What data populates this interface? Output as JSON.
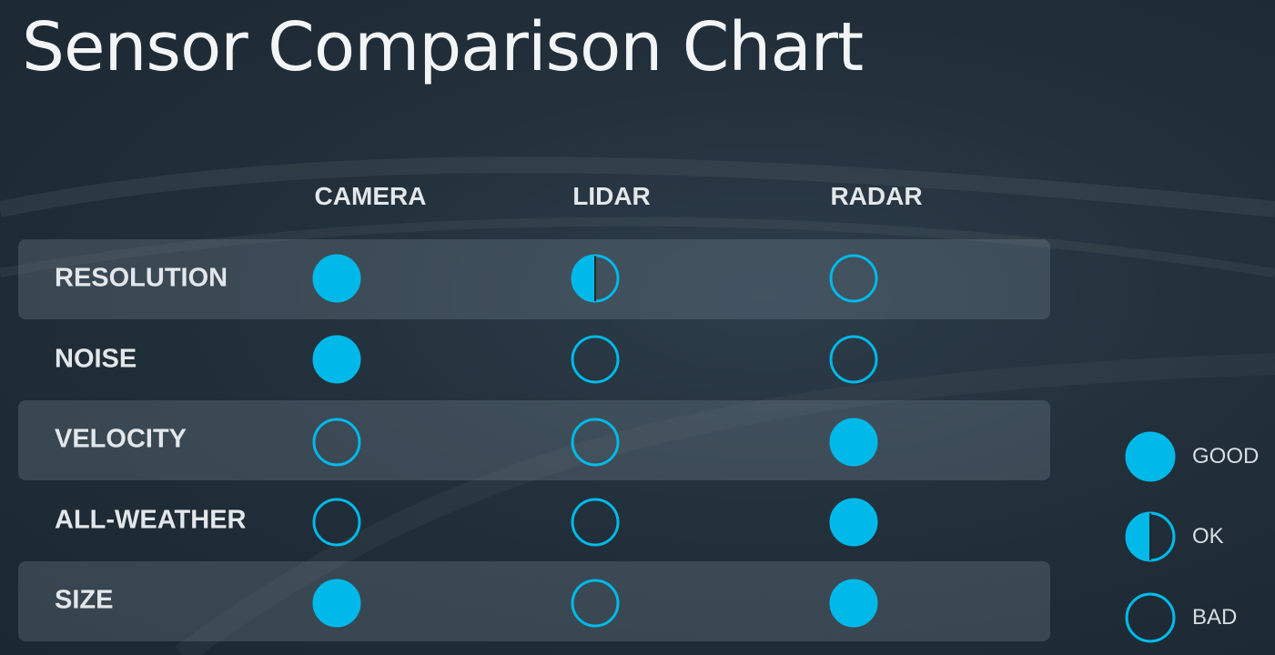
{
  "title": "Sensor Comparison Chart",
  "colors": {
    "accent": "#00b9e8",
    "good_fill": "#00b9e8",
    "ok_fill": "#00b9e8",
    "bad_stroke": "#00b9e8"
  },
  "columns": [
    "CAMERA",
    "LIDAR",
    "RADAR"
  ],
  "rows": [
    {
      "label": "RESOLUTION",
      "ratings": [
        "good",
        "ok",
        "bad"
      ]
    },
    {
      "label": "NOISE",
      "ratings": [
        "good",
        "bad",
        "bad"
      ]
    },
    {
      "label": "VELOCITY",
      "ratings": [
        "bad",
        "bad",
        "good"
      ]
    },
    {
      "label": "ALL-WEATHER",
      "ratings": [
        "bad",
        "bad",
        "good"
      ]
    },
    {
      "label": "SIZE",
      "ratings": [
        "good",
        "bad",
        "good"
      ]
    }
  ],
  "legend": [
    {
      "level": "good",
      "label": "GOOD"
    },
    {
      "level": "ok",
      "label": "OK"
    },
    {
      "level": "bad",
      "label": "BAD"
    }
  ]
}
